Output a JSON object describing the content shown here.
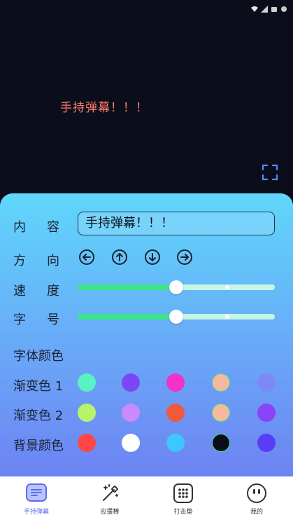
{
  "preview": {
    "barrage_text": "手持弹幕！！！",
    "barrage_color": "#ff7b6b",
    "background": "#0b0e1a",
    "fullscreen_icon": "fullscreen-icon"
  },
  "settings": {
    "content_label": "内容",
    "content_value": "手持弹幕！！！",
    "direction_label": "方向",
    "directions": [
      "left",
      "up",
      "down",
      "right"
    ],
    "speed_label": "速度",
    "speed_value": 50,
    "size_label": "字号",
    "size_value": 50,
    "font_color_heading": "字体颜色",
    "gradient1_label": "渐变色 1",
    "gradient2_label": "渐变色 2",
    "bg_color_label": "背景颜色",
    "gradient1_colors": [
      "#5af2c3",
      "#7a47f4",
      "#f133c8",
      "#f6b8a0",
      "#7a88f8"
    ],
    "gradient2_colors": [
      "#b8f36a",
      "#c98bf9",
      "#f05a3c",
      "#f6b8a0",
      "#8a43f6"
    ],
    "bg_colors": [
      "#ff4545",
      "#ffffff",
      "#3cc8fb",
      "#0b0e1a",
      "#5a3cf6"
    ]
  },
  "tabbar": {
    "tabs": [
      {
        "label": "手持弹幕",
        "icon": "barrage-icon",
        "active": true
      },
      {
        "label": "应援棒",
        "icon": "magic-wand-icon",
        "active": false
      },
      {
        "label": "打击垫",
        "icon": "drum-pad-icon",
        "active": false
      },
      {
        "label": "我的",
        "icon": "profile-face-icon",
        "active": false
      }
    ]
  }
}
